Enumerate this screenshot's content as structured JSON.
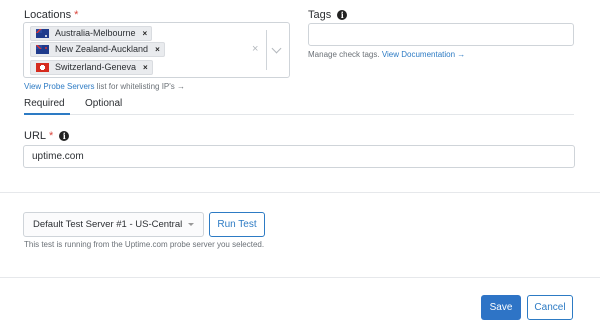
{
  "locations": {
    "label": "Locations",
    "required_mark": "*",
    "chips": [
      {
        "label": "Australia-Melbourne",
        "flag": "australia-flag-icon",
        "remove": "×"
      },
      {
        "label": "New Zealand-Auckland",
        "flag": "new-zealand-flag-icon",
        "remove": "×"
      },
      {
        "label": "Switzerland-Geneva",
        "flag": "switzerland-flag-icon",
        "remove": "×"
      }
    ],
    "clear": "×",
    "help_link": "View Probe Servers",
    "help_text": " list for whitelisting IP's →"
  },
  "tags": {
    "label": "Tags",
    "info": "i",
    "value": "",
    "help_text": "Manage check tags. ",
    "help_link": "View Documentation →"
  },
  "tabs": [
    {
      "label": "Required",
      "active": true
    },
    {
      "label": "Optional",
      "active": false
    }
  ],
  "url": {
    "label": "URL",
    "required_mark": "*",
    "info": "i",
    "value": "uptime.com"
  },
  "test": {
    "server": "Default Test Server #1 - US-Central",
    "run_label": "Run Test",
    "help_text": "This test is running from the Uptime.com probe server you selected."
  },
  "footer": {
    "save_label": "Save",
    "cancel_label": "Cancel"
  },
  "colors": {
    "accent": "#2d7bc4",
    "save_bg": "#2e74c6",
    "required": "#d9453c"
  }
}
